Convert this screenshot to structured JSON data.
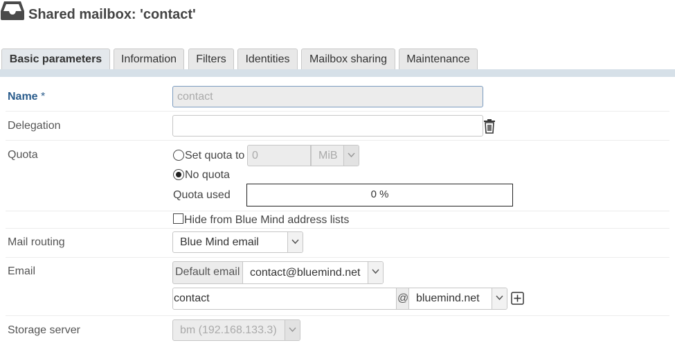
{
  "header": {
    "icon": "inbox-tray-icon",
    "title": "Shared mailbox: 'contact'"
  },
  "tabs": [
    {
      "label": "Basic parameters",
      "active": true
    },
    {
      "label": "Information",
      "active": false
    },
    {
      "label": "Filters",
      "active": false
    },
    {
      "label": "Identities",
      "active": false
    },
    {
      "label": "Mailbox sharing",
      "active": false
    },
    {
      "label": "Maintenance",
      "active": false
    }
  ],
  "form": {
    "name": {
      "label": "Name",
      "required_mark": "*",
      "value": "contact"
    },
    "delegation": {
      "label": "Delegation",
      "value": "",
      "delete_icon": "trash-icon"
    },
    "quota": {
      "label": "Quota",
      "set_quota_label": "Set quota to",
      "set_quota_value": "0",
      "unit": "MiB",
      "no_quota_label": "No quota",
      "selected": "no_quota",
      "used_label": "Quota used",
      "used_percent": 0,
      "used_text": "0 %"
    },
    "hide_from_lists": {
      "label": "Hide from Blue Mind address lists",
      "checked": false
    },
    "mail_routing": {
      "label": "Mail routing",
      "value": "Blue Mind email"
    },
    "email": {
      "label": "Email",
      "default_label": "Default email",
      "default_value": "contact@bluemind.net",
      "local_part": "contact",
      "at_sign": "@",
      "domain": "bluemind.net",
      "add_icon": "plus-square-icon"
    },
    "storage_server": {
      "label": "Storage server",
      "value": "bm (192.168.133.3)"
    }
  },
  "colors": {
    "required_label": "#2a5c8c",
    "tab_strip": "#d6e0e8",
    "quota_fill": "#3a87c9"
  }
}
